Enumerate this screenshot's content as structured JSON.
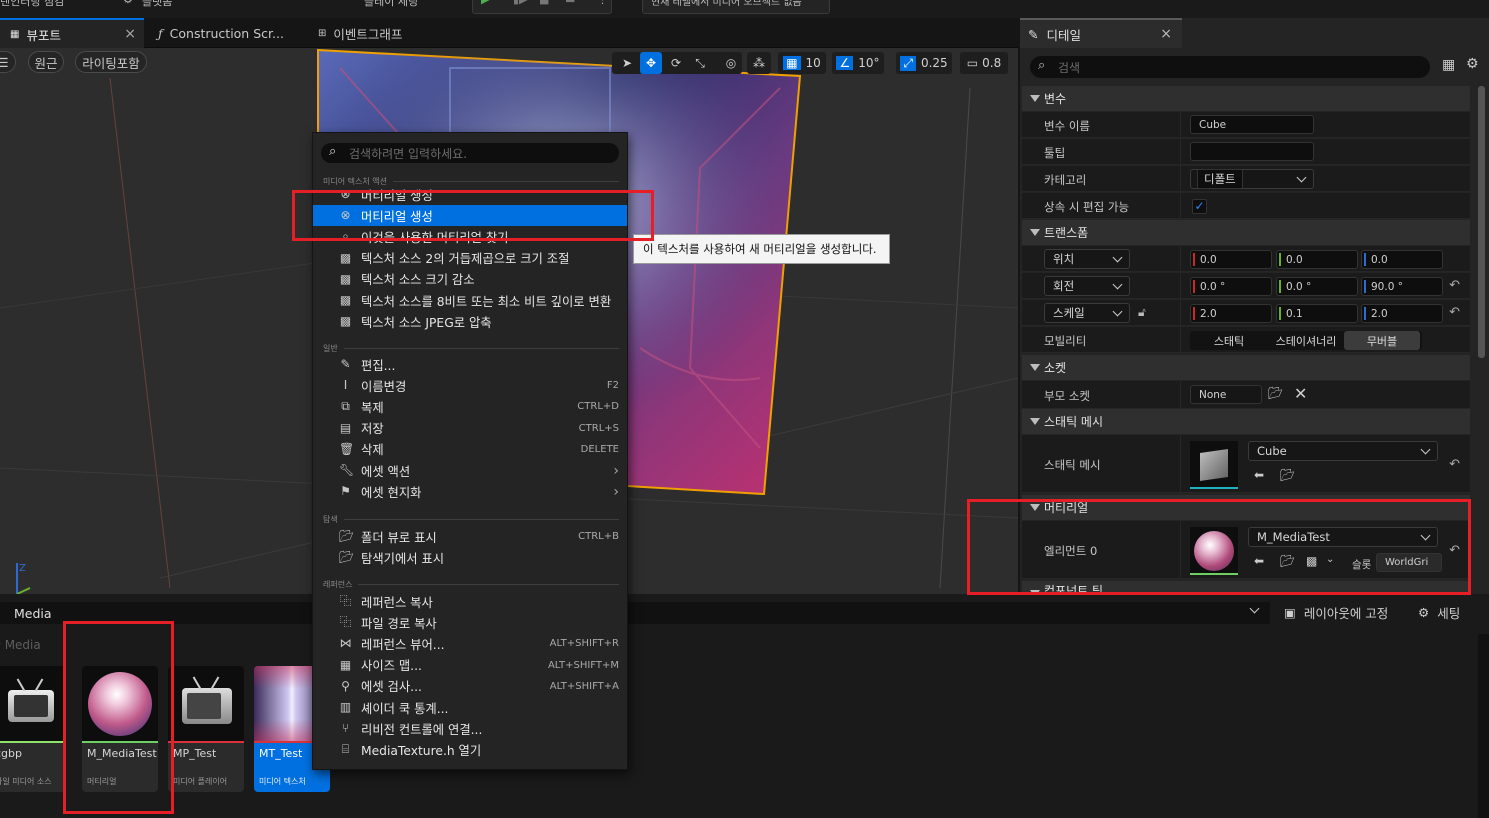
{
  "topbar": {
    "items": [
      "렌인터링 점검",
      "플랫폼",
      "플레이 세팅",
      "현재 레벨에서 미디어 오브젝트 없음"
    ]
  },
  "tabs": [
    {
      "label": "뷰포트",
      "active": true
    },
    {
      "label": "Construction Scr..."
    },
    {
      "label": "이벤트그래프"
    }
  ],
  "viewport": {
    "perspective": "원근",
    "lighting": "라이팅포함",
    "grid": "10",
    "angle": "10°",
    "scale": "0.25",
    "camera": "0.8",
    "axis_label": "Z"
  },
  "menu": {
    "search_placeholder": "검색하려면 입력하세요.",
    "sections": [
      {
        "header": "미디어 텍스처 액션",
        "items": [
          {
            "label": "머티리얼 생성",
            "icon": "material-icon"
          },
          {
            "label": "머티리얼 생성",
            "icon": "material-icon",
            "selected": true
          },
          {
            "label": "이것을 사용한 머티리얼 찾기",
            "icon": "search-icon"
          },
          {
            "label": "텍스처 소스 2의 거듭제곱으로 크기 조절",
            "icon": "texture-icon"
          },
          {
            "label": "텍스처 소스 크기 감소",
            "icon": "texture-icon"
          },
          {
            "label": "텍스처 소스를 8비트 또는 최소 비트 깊이로 변환",
            "icon": "texture-icon"
          },
          {
            "label": "텍스처 소스 JPEG로 압축",
            "icon": "texture-icon"
          }
        ]
      },
      {
        "header": "일반",
        "items": [
          {
            "label": "편집...",
            "icon": "pencil-icon"
          },
          {
            "label": "이름변경",
            "icon": "rename-icon",
            "shortcut": "F2"
          },
          {
            "label": "복제",
            "icon": "duplicate-icon",
            "shortcut": "CTRL+D"
          },
          {
            "label": "저장",
            "icon": "save-icon",
            "shortcut": "CTRL+S"
          },
          {
            "label": "삭제",
            "icon": "trash-icon",
            "shortcut": "DELETE"
          },
          {
            "label": "에셋 액션",
            "icon": "wrench-icon",
            "submenu": true
          },
          {
            "label": "에셋 현지화",
            "icon": "flag-icon",
            "submenu": true
          }
        ]
      },
      {
        "header": "탐색",
        "items": [
          {
            "label": "폴더 뷰로 표시",
            "icon": "folder-search-icon",
            "shortcut": "CTRL+B"
          },
          {
            "label": "탐색기에서 표시",
            "icon": "folder-search-icon"
          }
        ]
      },
      {
        "header": "레퍼런스",
        "items": [
          {
            "label": "레퍼런스 복사",
            "icon": "copy-ref-icon"
          },
          {
            "label": "파일 경로 복사",
            "icon": "copy-ref-icon"
          },
          {
            "label": "레퍼런스 뷰어...",
            "icon": "ref-viewer-icon",
            "shortcut": "ALT+SHIFT+R"
          },
          {
            "label": "사이즈 맵...",
            "icon": "size-map-icon",
            "shortcut": "ALT+SHIFT+M"
          },
          {
            "label": "에셋 검사...",
            "icon": "audit-icon",
            "shortcut": "ALT+SHIFT+A"
          },
          {
            "label": "셰이더 쿡 통계...",
            "icon": "stats-icon"
          },
          {
            "label": "리비전 컨트롤에 연결...",
            "icon": "branch-icon"
          },
          {
            "label": "MediaTexture.h 열기",
            "icon": "code-icon"
          }
        ]
      }
    ],
    "tooltip": "이 텍스처를 사용하여 새 머티리얼을 생성합니다."
  },
  "details": {
    "tab": "디테일",
    "search_placeholder": "검색",
    "variable": {
      "header": "변수",
      "name_label": "변수 이름",
      "name_value": "Cube",
      "tooltip_label": "툴팁",
      "tooltip_value": "",
      "category_label": "카테고리",
      "category_value": "디폴트",
      "editable_label": "상속 시 편집 가능",
      "editable_checked": true
    },
    "transform": {
      "header": "트랜스폼",
      "location_label": "위치",
      "location": [
        "0.0",
        "0.0",
        "0.0"
      ],
      "rotation_label": "회전",
      "rotation": [
        "0.0 °",
        "0.0 °",
        "90.0 °"
      ],
      "scale_label": "스케일",
      "scale": [
        "2.0",
        "0.1",
        "2.0"
      ],
      "mobility_label": "모빌리티",
      "mobility_options": [
        "스태틱",
        "스테이셔너리",
        "무버블"
      ],
      "mobility_selected": "무버블"
    },
    "socket": {
      "header": "소켓",
      "parent_label": "부모 소켓",
      "parent_value": "None"
    },
    "static_mesh": {
      "header": "스태틱 메시",
      "label": "스태틱 메시",
      "value": "Cube"
    },
    "materials": {
      "header": "머티리얼",
      "element_label": "엘리먼트 0",
      "value": "M_MediaTest",
      "slot_label": "슬롯",
      "slot_value": "WorldGri"
    },
    "next_header": "컴포넌트 틱"
  },
  "content": {
    "path_title": "Media",
    "lock_layout": "레이아웃에 고정",
    "settings": "세팅",
    "path_crumb": "Media",
    "assets": [
      {
        "name": "cgbp",
        "type": "파일 미디어 소스",
        "thumb": "tv-icon",
        "color": "#8fe36b"
      },
      {
        "name": "M_MediaTest",
        "type": "머티리얼",
        "thumb": "material-sphere",
        "color": "#6bd061"
      },
      {
        "name": "MP_Test",
        "type": "미디어 플레이어",
        "thumb": "tv-icon",
        "color": "#d9323a"
      },
      {
        "name": "MT_Test",
        "type": "미디어 텍스처",
        "thumb": "texture-preview",
        "color": "#d9323a",
        "selected": true
      }
    ]
  },
  "colors": {
    "accent": "#0070e0",
    "highlight_box": "#e61e25",
    "selection_outline": "#f0a000"
  }
}
